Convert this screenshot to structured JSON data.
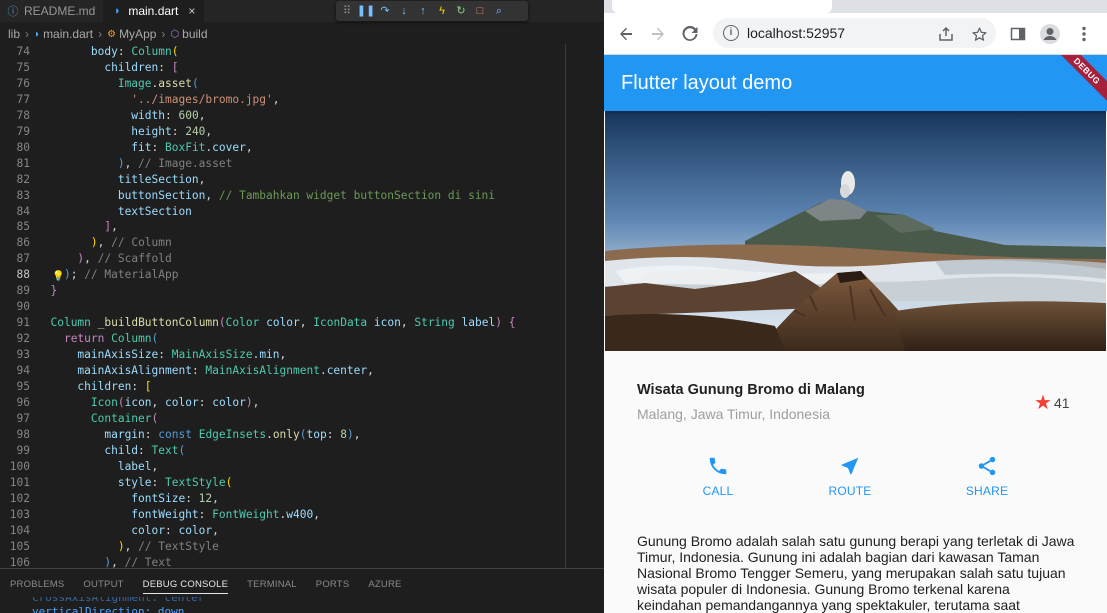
{
  "vscode": {
    "tabs": [
      {
        "label": "README.md",
        "icon": "info-icon",
        "active": false
      },
      {
        "label": "main.dart",
        "icon": "dart-icon",
        "active": true,
        "close": "×"
      }
    ],
    "breadcrumb": [
      "lib",
      "main.dart",
      "MyApp",
      "build"
    ],
    "code_lines": [
      {
        "n": "74",
        "html": "        <span class=\"v\">body</span>: <span class=\"c\">Column</span><span class=\"p\">(</span>"
      },
      {
        "n": "75",
        "html": "          <span class=\"v\">children</span>: <span class=\"ctl\">[</span>"
      },
      {
        "n": "76",
        "html": "            <span class=\"c\">Image</span>.<span class=\"f\">asset</span><span class=\"k\">(</span>"
      },
      {
        "n": "77",
        "html": "              <span class=\"s\">'../images/bromo.jpg'</span>,"
      },
      {
        "n": "78",
        "html": "              <span class=\"v\">width</span>: <span class=\"n\">600</span>,"
      },
      {
        "n": "79",
        "html": "              <span class=\"v\">height</span>: <span class=\"n\">240</span>,"
      },
      {
        "n": "80",
        "html": "              <span class=\"v\">fit</span>: <span class=\"c\">BoxFit</span>.<span class=\"v\">cover</span>,"
      },
      {
        "n": "81",
        "html": "            <span class=\"k\">)</span>, <span class=\"g\">// Image.asset</span>"
      },
      {
        "n": "82",
        "html": "            <span class=\"v\">titleSection</span>,"
      },
      {
        "n": "83",
        "html": "            <span class=\"v\">buttonSection</span>, <span class=\"cm\">// Tambahkan widget buttonSection di sini</span>"
      },
      {
        "n": "84",
        "html": "            <span class=\"v\">textSection</span>"
      },
      {
        "n": "85",
        "html": "          <span class=\"ctl\">]</span>,"
      },
      {
        "n": "86",
        "html": "        <span class=\"p\">)</span>, <span class=\"g\">// Column</span>"
      },
      {
        "n": "87",
        "html": "      <span class=\"ctl\">)</span>, <span class=\"g\">// Scaffold</span>"
      },
      {
        "n": "88",
        "html": "    <span class=\"k\">)</span>; <span class=\"g\">// MaterialApp</span>",
        "current": true
      },
      {
        "n": "89",
        "html": "  <span class=\"ctl\">}</span>"
      },
      {
        "n": "90",
        "html": ""
      },
      {
        "n": "91",
        "html": "  <span class=\"c\">Column</span> <span class=\"f\">_buildButtonColumn</span><span class=\"ctl\">(</span><span class=\"c\">Color</span> <span class=\"v\">color</span>, <span class=\"c\">IconData</span> <span class=\"v\">icon</span>, <span class=\"c\">String</span> <span class=\"v\">label</span><span class=\"ctl\">)</span> <span class=\"ctl\">{</span>"
      },
      {
        "n": "92",
        "html": "    <span class=\"ctl\">return</span> <span class=\"c\">Column</span><span class=\"k\">(</span>"
      },
      {
        "n": "93",
        "html": "      <span class=\"v\">mainAxisSize</span>: <span class=\"c\">MainAxisSize</span>.<span class=\"v\">min</span>,"
      },
      {
        "n": "94",
        "html": "      <span class=\"v\">mainAxisAlignment</span>: <span class=\"c\">MainAxisAlignment</span>.<span class=\"v\">center</span>,"
      },
      {
        "n": "95",
        "html": "      <span class=\"v\">children</span>: <span class=\"p\">[</span>"
      },
      {
        "n": "96",
        "html": "        <span class=\"c\">Icon</span><span class=\"ctl\">(</span><span class=\"v\">icon</span>, <span class=\"v\">color</span>: <span class=\"v\">color</span><span class=\"ctl\">)</span>,"
      },
      {
        "n": "97",
        "html": "        <span class=\"c\">Container</span><span class=\"ctl\">(</span>"
      },
      {
        "n": "98",
        "html": "          <span class=\"v\">margin</span>: <span class=\"k\">const</span> <span class=\"c\">EdgeInsets</span>.<span class=\"f\">only</span><span class=\"k\">(</span><span class=\"v\">top</span>: <span class=\"n\">8</span><span class=\"k\">)</span>,"
      },
      {
        "n": "99",
        "html": "          <span class=\"v\">child</span>: <span class=\"c\">Text</span><span class=\"k\">(</span>"
      },
      {
        "n": "100",
        "html": "            <span class=\"v\">label</span>,"
      },
      {
        "n": "101",
        "html": "            <span class=\"v\">style</span>: <span class=\"c\">TextStyle</span><span class=\"p\">(</span>"
      },
      {
        "n": "102",
        "html": "              <span class=\"v\">fontSize</span>: <span class=\"n\">12</span>,"
      },
      {
        "n": "103",
        "html": "              <span class=\"v\">fontWeight</span>: <span class=\"c\">FontWeight</span>.<span class=\"v\">w400</span>,"
      },
      {
        "n": "104",
        "html": "              <span class=\"v\">color</span>: <span class=\"v\">color</span>,"
      },
      {
        "n": "105",
        "html": "            <span class=\"p\">)</span>, <span class=\"g\">// TextStyle</span>"
      },
      {
        "n": "106",
        "html": "          <span class=\"k\">)</span>, <span class=\"g\">// Text</span>"
      }
    ],
    "panel": {
      "tabs": [
        "PROBLEMS",
        "OUTPUT",
        "DEBUG CONSOLE",
        "TERMINAL",
        "PORTS",
        "AZURE"
      ],
      "active_tab": "DEBUG CONSOLE",
      "trace_partial": "crossAxisAlignment: center",
      "trace": "verticalDirection: down"
    }
  },
  "browser": {
    "url": "localhost:52957",
    "app_title": "Flutter layout demo",
    "debug_banner": "DEBUG",
    "place_title": "Wisata Gunung Bromo di Malang",
    "place_subtitle": "Malang, Jawa Timur, Indonesia",
    "rating_count": "41",
    "buttons": [
      {
        "label": "CALL",
        "icon": "phone-icon"
      },
      {
        "label": "ROUTE",
        "icon": "near-me-icon"
      },
      {
        "label": "SHARE",
        "icon": "share-icon"
      }
    ],
    "description": "Gunung Bromo adalah salah satu gunung berapi yang terletak di Jawa Timur, Indonesia. Gunung ini adalah bagian dari kawasan Taman Nasional Bromo Tengger Semeru, yang merupakan salah satu tujuan wisata populer di Indonesia. Gunung Bromo terkenal karena keindahan pemandangannya yang spektakuler, terutama saat",
    "accent_color": "#2196f3",
    "star_color": "#f44336"
  }
}
